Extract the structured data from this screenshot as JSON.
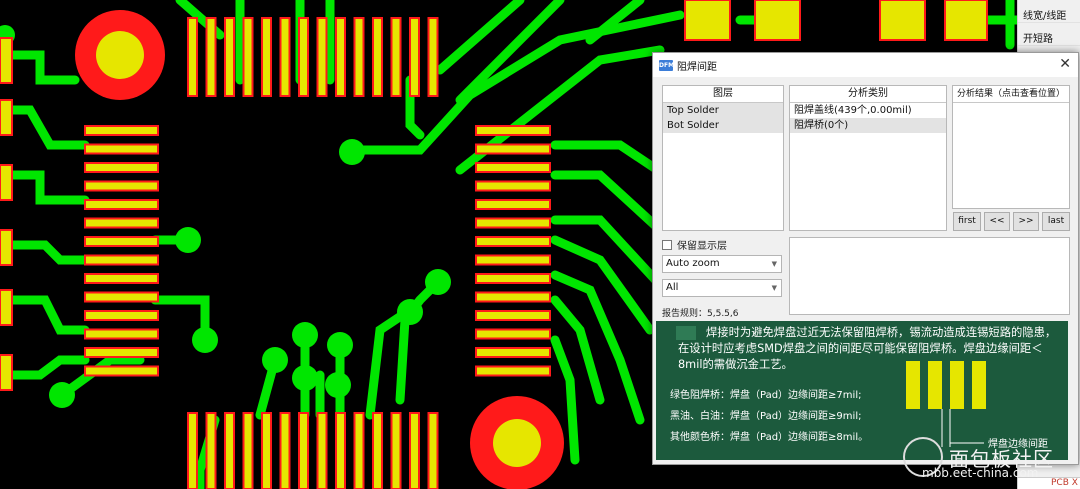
{
  "side_panel": {
    "items": [
      "线宽/线距",
      "开短路"
    ],
    "bottom_label": "PCB X"
  },
  "dialog": {
    "app_icon_text": "DFM",
    "title": "阻焊间距",
    "close_glyph": "✕",
    "layers": {
      "header": "图层",
      "items": [
        {
          "label": "Top Solder",
          "selected": true
        },
        {
          "label": "Bot Solder",
          "selected": true
        }
      ]
    },
    "categories": {
      "header": "分析类别",
      "items": [
        {
          "label": "阻焊盖线(439个,0.00mil)",
          "selected": false
        },
        {
          "label": "阻焊桥(0个)",
          "selected": true
        }
      ]
    },
    "results": {
      "header": "分析结果（点击查看位置）"
    },
    "nav_buttons": [
      "first",
      "<<",
      ">>",
      "last"
    ],
    "keep_layer_label": "保留显示层",
    "zoom_select": {
      "value": "Auto zoom"
    },
    "filter_select": {
      "value": "All"
    },
    "rule_text": "报告规则：5,5.5,6",
    "info": {
      "paragraph": "焊接时为避免焊盘过近无法保留阻焊桥，锡流动造成连锡短路的隐患，在设计时应考虑SMD焊盘之间的间距尽可能保留阻焊桥。焊盘边缘间距＜8mil的需做沉金工艺。",
      "line1": "绿色阻焊桥：焊盘（Pad）边缘间距≥7mil;",
      "line2": "黑油、白油：焊盘（Pad）边缘间距≥9mil;",
      "line3": "其他颜色桥：焊盘（Pad）边缘间距≥8mil。",
      "diagram_label": "焊盘边缘间距"
    }
  },
  "watermark": {
    "title": "面包板社区",
    "url": "mbb.eet-china.com"
  },
  "colors": {
    "pcb_background": "#000000",
    "trace": "#00e600",
    "pad_fill": "#e6e600",
    "pad_outline": "#ff1a1a",
    "info_panel": "#1c5a3d"
  }
}
